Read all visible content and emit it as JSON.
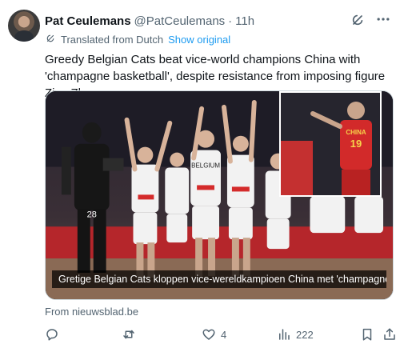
{
  "author": {
    "name": "Pat Ceulemans",
    "handle": "@PatCeulemans",
    "separator": "·",
    "time": "11h"
  },
  "translation": {
    "note": "Translated from Dutch",
    "show_original": "Show original"
  },
  "tweet_text": "Greedy Belgian Cats beat vice-world champions China with 'champagne basketball', despite resistance from imposing figure Ziyu Zhang",
  "media": {
    "caption": "Gretige Belgian Cats kloppen vice-wereldkampioen China met 'champagnebas...",
    "jersey_belgium": "BELGIUM",
    "jersey_china": "CHINA",
    "china_number": "19",
    "photographer_number": "28"
  },
  "source": "From nieuwsblad.be",
  "actions": {
    "reply_count": "",
    "retweet_count": "",
    "like_count": "4",
    "views_count": "222"
  },
  "icons": {
    "grok": "grok-icon",
    "more": "more-icon",
    "translate": "translate-icon",
    "reply": "reply-icon",
    "retweet": "retweet-icon",
    "like": "heart-icon",
    "views": "views-icon",
    "bookmark": "bookmark-icon",
    "share": "share-icon"
  },
  "colors": {
    "link": "#1d9bf0",
    "muted": "#536471",
    "text": "#0f1419",
    "china_red": "#d22a2a"
  }
}
